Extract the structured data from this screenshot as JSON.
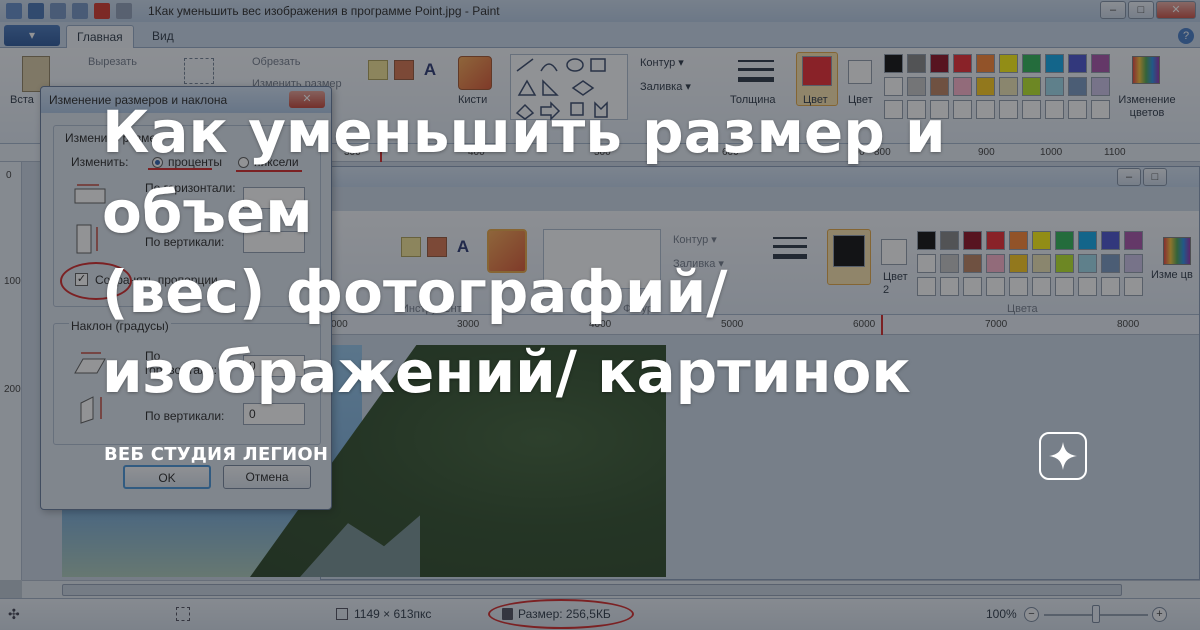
{
  "window": {
    "title": "1Как уменьшить вес изображения в программе Point.jpg - Paint",
    "minimize": "–",
    "maximize": "□",
    "close": "✕"
  },
  "ribbon": {
    "app_menu": "▾",
    "tabs": [
      {
        "label": "Главная",
        "active": true
      },
      {
        "label": "Вид",
        "active": false
      }
    ],
    "help": "?",
    "clipboard": {
      "paste": "Вста",
      "cut": "Вырезать"
    },
    "image": {
      "crop": "Обрезать",
      "resize_partial": "Изменить размер"
    },
    "brushes": "Кисти",
    "outline": "Контур ▾",
    "fill": "Заливка ▾",
    "thickness": "Толщина",
    "color1": "Цвет",
    "color2": "Цвет",
    "edit_colors": "Изменение цветов"
  },
  "inner_ribbon": {
    "outline": "Контур ▾",
    "fill": "Заливка ▾",
    "color2": "Цвет 2",
    "edit_colors": "Изме цв",
    "group_tools": "Инструменты",
    "group_shapes": "Фигуры",
    "group_colors": "Цвета"
  },
  "palette": {
    "row1": [
      "#000000",
      "#7f7f7f",
      "#880015",
      "#ed1c24",
      "#ff7f27",
      "#fff200",
      "#22b14c",
      "#00a2e8",
      "#3f48cc",
      "#a349a4"
    ],
    "row2": [
      "#ffffff",
      "#c3c3c3",
      "#b97a57",
      "#ffaec9",
      "#ffc90e",
      "#efe4b0",
      "#b5e61d",
      "#99d9ea",
      "#7092be",
      "#c8bfe7"
    ],
    "row3": [
      "#ffffff",
      "#ffffff",
      "#ffffff",
      "#ffffff",
      "#ffffff",
      "#ffffff",
      "#ffffff",
      "#ffffff",
      "#ffffff",
      "#ffffff"
    ],
    "main_color1": "#ed1c24",
    "main_color2": "#ffffff",
    "inner_color1": "#000000"
  },
  "rulers": {
    "top": [
      "300",
      "400",
      "500",
      "600",
      "700",
      "800",
      "900",
      "1000",
      "1100"
    ],
    "inner_top": [
      "000",
      "3000",
      "4000",
      "5000",
      "6000",
      "7000",
      "8000"
    ],
    "left": [
      "0",
      "100",
      "200"
    ]
  },
  "dialog": {
    "title": "Изменение размеров и наклона",
    "close": "✕",
    "resize_group": "Изменить размер",
    "by_label": "Изменить:",
    "option_percent": "проценты",
    "option_pixels": "пиксели",
    "horizontal_label": "По горизонтали:",
    "vertical_label": "По вертикали:",
    "keep_ratio": "Сохранять пропорции",
    "skew_group": "Наклон (градусы)",
    "skew_h_label": "По горизонтали:",
    "skew_h_value": "0",
    "skew_v_label": "По вертикали:",
    "skew_v_value": "0",
    "ok": "OK",
    "cancel": "Отмена"
  },
  "status": {
    "dimensions": "1149 × 613пкс",
    "size": "Размер: 256,5КБ",
    "zoom": "100%",
    "zoom_out": "−",
    "zoom_in": "+"
  },
  "headline": {
    "line1": "Как уменьшить размер и объем",
    "line2": "(вес) фотографий/",
    "line3": "изображений/ картинок"
  },
  "brand": "ВЕБ СТУДИЯ ЛЕГИОН",
  "colors": {
    "accent_red": "#d11a1a",
    "overlay": "#26282c"
  }
}
